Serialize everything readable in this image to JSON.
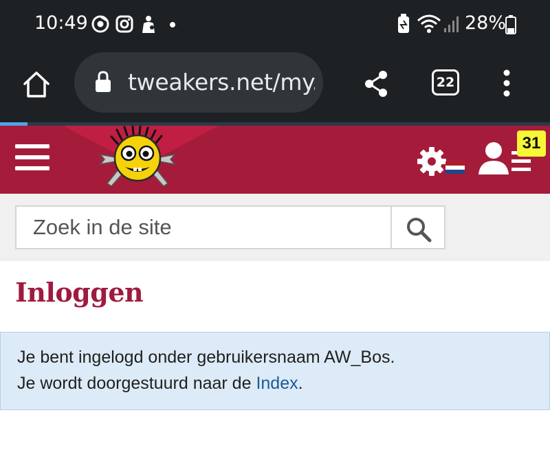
{
  "status_bar": {
    "time": "10:49",
    "battery_percent": "28%",
    "notification_icons": [
      "chrome-icon",
      "instagram-icon",
      "gift-icon",
      "dot-icon"
    ],
    "system_icons": [
      "battery-saver-icon",
      "wifi-icon",
      "signal-icon",
      "battery-icon"
    ]
  },
  "browser": {
    "url": "tweakers.net/my.",
    "tab_count": "22"
  },
  "site": {
    "notification_count": "31",
    "search_placeholder": "Zoek in de site",
    "brand_color": "#a51c3b"
  },
  "page": {
    "title": "Inloggen",
    "message_line1": "Je bent ingelogd onder gebruikersnaam AW_Bos.",
    "message_line2_prefix": "Je wordt doorgestuurd naar de ",
    "message_link": "Index",
    "message_line2_suffix": "."
  }
}
